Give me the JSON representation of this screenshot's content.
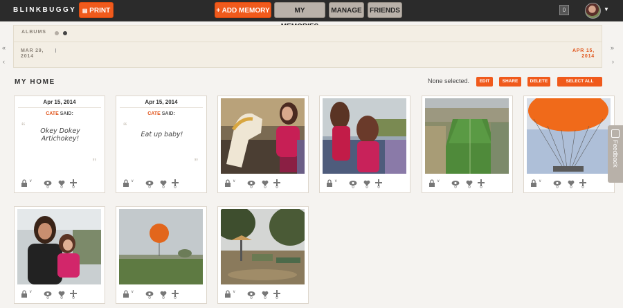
{
  "topbar": {
    "logo": "BLINKBUGGY",
    "print_label": "PRINT",
    "add_memory_label": "+ ADD MEMORY",
    "nav": [
      "MY MEMORIES",
      "MANAGE",
      "FRIENDS"
    ],
    "notification_count": "0"
  },
  "albums": {
    "label": "ALBUMS"
  },
  "timeline": {
    "start_month": "MAR 29,",
    "start_year": "2014",
    "end_month": "APR 15,",
    "end_year": "2014",
    "prev_icon": "double-chevron-left-icon",
    "next_icon": "double-chevron-right-icon"
  },
  "main": {
    "title": "MY HOME",
    "selection_status": "None selected.",
    "actions": [
      "EDIT",
      "SHARE",
      "DELETE",
      "SELECT ALL"
    ]
  },
  "notes": [
    {
      "date": "Apr 15, 2014",
      "author": "CATE",
      "said": "SAID:",
      "text": "Okey Dokey Artichokey!"
    },
    {
      "date": "Apr 15, 2014",
      "author": "CATE",
      "said": "SAID:",
      "text": "Eat up baby!"
    }
  ],
  "card_stats": {
    "views": "0",
    "likes": "0",
    "adds": "0"
  },
  "feedback_label": "Feedback",
  "colors": {
    "accent": "#f05a1c",
    "topbar": "#2b2b2b",
    "band": "#f3eee4"
  }
}
